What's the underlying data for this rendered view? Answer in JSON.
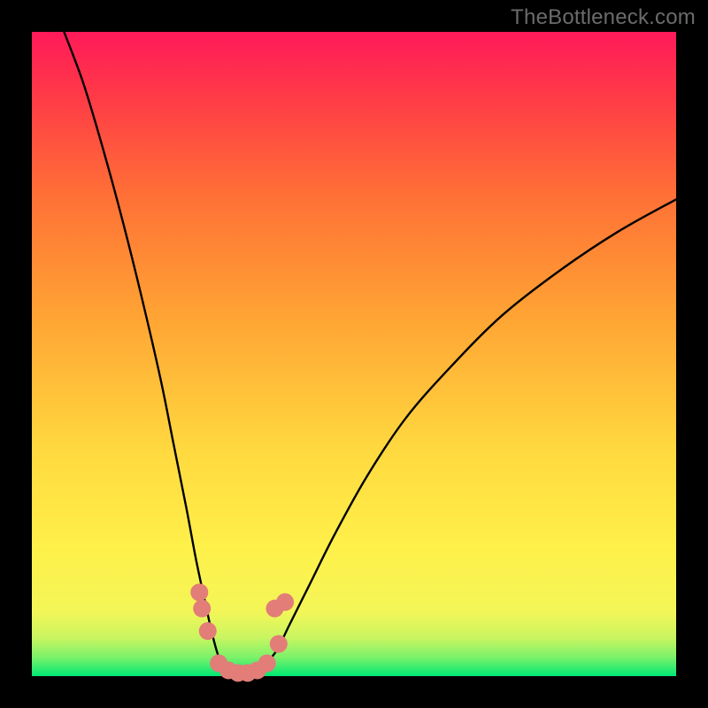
{
  "watermark": "TheBottleneck.com",
  "chart_data": {
    "type": "line",
    "title": "",
    "xlabel": "",
    "ylabel": "",
    "xlim": [
      0,
      100
    ],
    "ylim": [
      0,
      100
    ],
    "background_gradient_stops": [
      {
        "pos": 0.0,
        "color": "#00e874"
      },
      {
        "pos": 0.03,
        "color": "#7ef26a"
      },
      {
        "pos": 0.06,
        "color": "#c9f560"
      },
      {
        "pos": 0.1,
        "color": "#f3f658"
      },
      {
        "pos": 0.2,
        "color": "#fff04a"
      },
      {
        "pos": 0.35,
        "color": "#ffd93f"
      },
      {
        "pos": 0.55,
        "color": "#ffa634"
      },
      {
        "pos": 0.75,
        "color": "#ff6f36"
      },
      {
        "pos": 0.9,
        "color": "#ff3a47"
      },
      {
        "pos": 1.0,
        "color": "#ff1a59"
      }
    ],
    "series": [
      {
        "name": "left-curve",
        "color": "#000000",
        "x": [
          5,
          8,
          11,
          14,
          17,
          20,
          22,
          24,
          25.5,
          27,
          28,
          29,
          30
        ],
        "y": [
          100,
          92,
          82,
          71,
          59,
          46,
          36,
          26,
          18,
          11,
          6.5,
          3,
          1.5
        ]
      },
      {
        "name": "right-curve",
        "color": "#000000",
        "x": [
          36,
          38,
          40,
          43,
          47,
          52,
          58,
          65,
          73,
          82,
          91,
          100
        ],
        "y": [
          1.5,
          4,
          8,
          14,
          22,
          31,
          40,
          48,
          56,
          63,
          69,
          74
        ]
      },
      {
        "name": "valley-floor",
        "color": "#000000",
        "x": [
          30,
          31.5,
          33,
          34.5,
          36
        ],
        "y": [
          1.5,
          0.6,
          0.3,
          0.6,
          1.5
        ]
      }
    ],
    "markers": {
      "name": "highlight-dots",
      "color": "#e27d78",
      "radius_px": 10,
      "points": [
        {
          "x": 26.0,
          "y": 13.0
        },
        {
          "x": 26.4,
          "y": 10.5
        },
        {
          "x": 27.3,
          "y": 7.0
        },
        {
          "x": 29.0,
          "y": 2.0
        },
        {
          "x": 30.5,
          "y": 0.9
        },
        {
          "x": 32.0,
          "y": 0.5
        },
        {
          "x": 33.5,
          "y": 0.5
        },
        {
          "x": 35.0,
          "y": 0.9
        },
        {
          "x": 36.5,
          "y": 2.0
        },
        {
          "x": 38.3,
          "y": 5.0
        },
        {
          "x": 37.7,
          "y": 10.5
        },
        {
          "x": 39.3,
          "y": 11.5
        }
      ]
    }
  }
}
